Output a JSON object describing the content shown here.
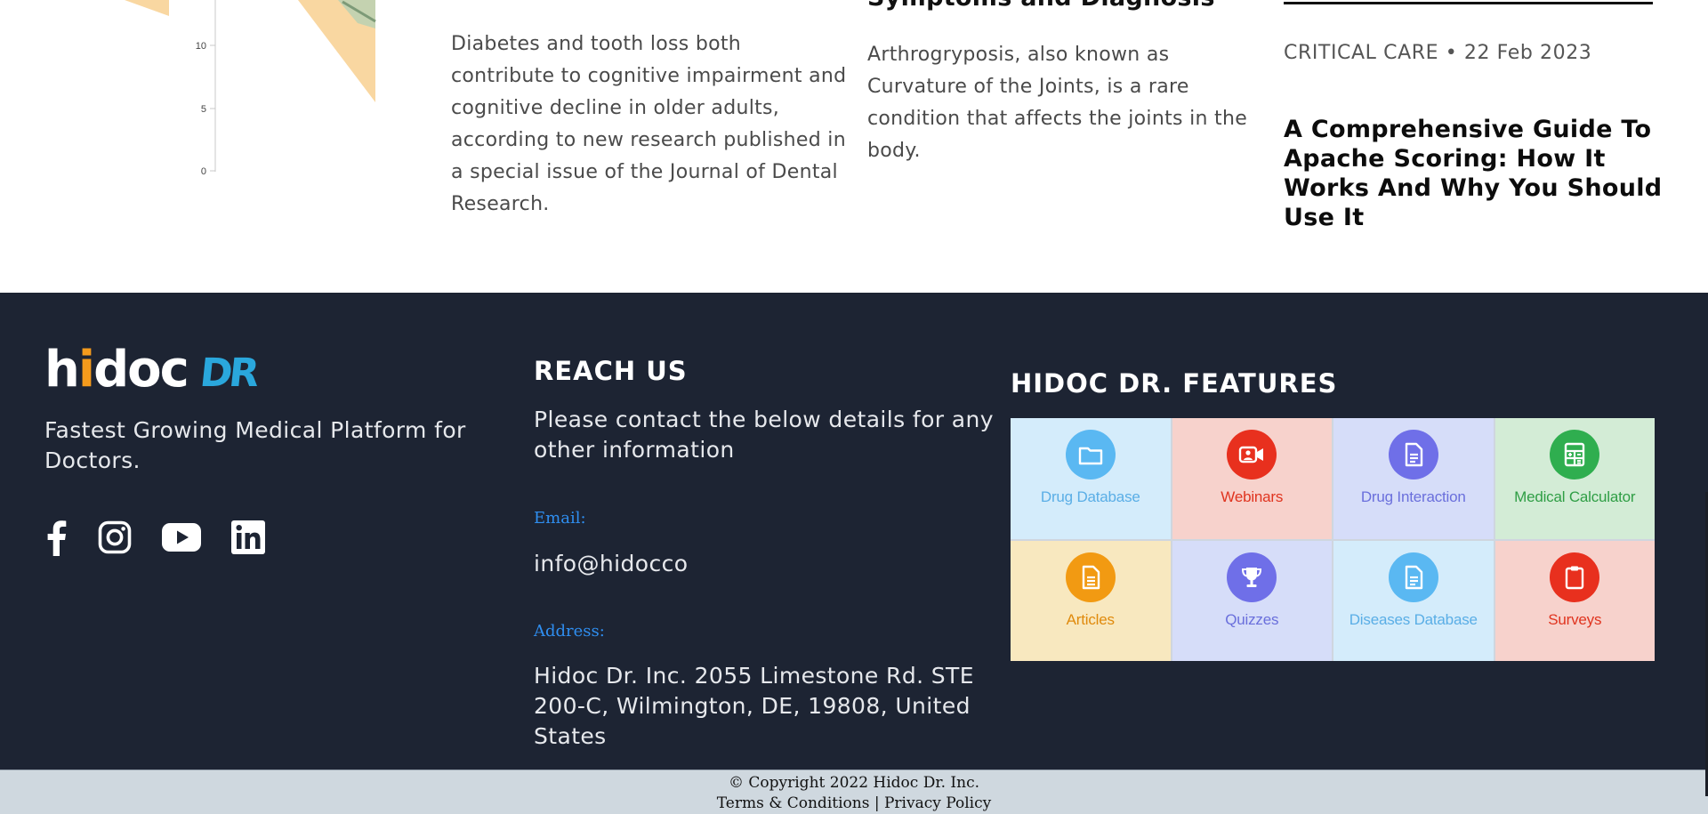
{
  "chart_thumbnail": {
    "y_ticks": [
      "10",
      "5",
      "0"
    ]
  },
  "articles": {
    "col1_excerpt": "Diabetes and tooth loss both contribute to cognitive impairment and cognitive decline in older adults, according to new research published in a special issue of the Journal of Dental Research.",
    "col2_clipped_title": "Symptoms and Diagnosis",
    "col2_excerpt": "Arthrogryposis, also known as Curvature of the Joints, is a rare condition that affects the joints in the body.",
    "col3_meta": "CRITICAL CARE • 22 Feb 2023",
    "col3_title": "A Comprehensive Guide To Apache Scoring: How It Works And Why You Should Use It"
  },
  "footer": {
    "logo_main": "hidoc",
    "logo_dr": "DR",
    "tagline": "Fastest Growing Medical Platform for Doctors.",
    "social": [
      {
        "icon": "facebook-icon"
      },
      {
        "icon": "instagram-icon"
      },
      {
        "icon": "youtube-icon"
      },
      {
        "icon": "linkedin-icon"
      }
    ],
    "reach_title": "REACH US",
    "reach_desc": "Please contact the below details for any other information",
    "email_label": "Email:",
    "email_value": "info@hidocco",
    "address_label": "Address:",
    "address_value": "Hidoc Dr. Inc. 2055 Limestone Rd. STE 200-C, Wilmington, DE, 19808, United States",
    "features_title": "HIDOC DR. FEATURES",
    "features": [
      {
        "label": "Drug Database",
        "icon": "folder-icon",
        "bg": "#d4ecfb",
        "circle": "#5ab8f2",
        "text": "#5aaee6"
      },
      {
        "label": "Webinars",
        "icon": "video-icon",
        "bg": "#f7d2cc",
        "circle": "#e8301e",
        "text": "#e0341f"
      },
      {
        "label": "Drug Interaction",
        "icon": "document-icon",
        "bg": "#d6ddf9",
        "circle": "#6f6fe8",
        "text": "#6a6fdc"
      },
      {
        "label": "Medical Calculator",
        "icon": "calculator-icon",
        "bg": "#d3ecd6",
        "circle": "#2fae4f",
        "text": "#2f9e45"
      },
      {
        "label": "Articles",
        "icon": "article-icon",
        "bg": "#f8e8bf",
        "circle": "#f29a12",
        "text": "#e08a0c"
      },
      {
        "label": "Quizzes",
        "icon": "trophy-icon",
        "bg": "#d6ddf9",
        "circle": "#6f6fe8",
        "text": "#6a6fdc"
      },
      {
        "label": "Diseases Database",
        "icon": "document-icon",
        "bg": "#d4ecfb",
        "circle": "#5ab8f2",
        "text": "#5aaee6"
      },
      {
        "label": "Surveys",
        "icon": "clipboard-icon",
        "bg": "#f7d2cc",
        "circle": "#e8301e",
        "text": "#e0341f"
      }
    ]
  },
  "copyright": {
    "text": "© Copyright 2022 Hidoc Dr. Inc.",
    "terms": "Terms & Conditions",
    "separator": "|",
    "privacy": "Privacy Policy"
  }
}
